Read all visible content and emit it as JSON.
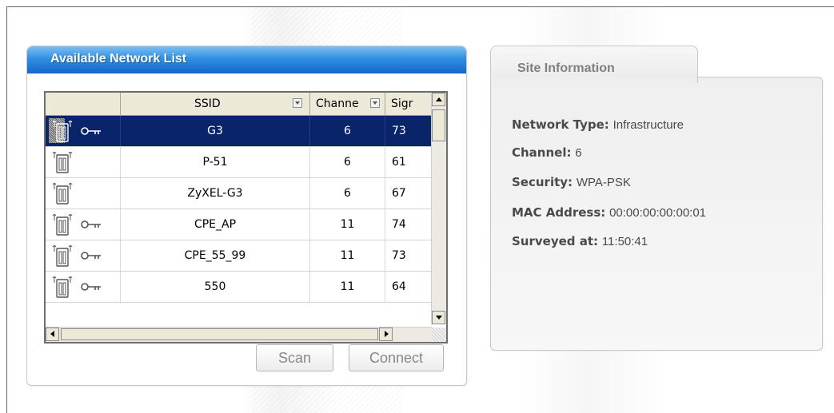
{
  "colors": {
    "header_blue": "#1f7ad8",
    "selected_row": "#0a246a",
    "panel_border": "#c8c8c8",
    "muted_text": "#888888"
  },
  "network_list": {
    "title": "Available Network List",
    "columns": [
      "",
      "SSID",
      "Channe",
      "Sigr"
    ],
    "rows": [
      {
        "ssid": "G3",
        "channel": "6",
        "signal": "73",
        "encrypted": true,
        "selected": true,
        "icon": "access-point-icon"
      },
      {
        "ssid": "P-51",
        "channel": "6",
        "signal": "61",
        "encrypted": false,
        "selected": false,
        "icon": "access-point-icon"
      },
      {
        "ssid": "ZyXEL-G3",
        "channel": "6",
        "signal": "67",
        "encrypted": false,
        "selected": false,
        "icon": "access-point-icon"
      },
      {
        "ssid": "CPE_AP",
        "channel": "11",
        "signal": "74",
        "encrypted": true,
        "selected": false,
        "icon": "access-point-icon"
      },
      {
        "ssid": "CPE_55_99",
        "channel": "11",
        "signal": "73",
        "encrypted": true,
        "selected": false,
        "icon": "access-point-icon"
      },
      {
        "ssid": "550",
        "channel": "11",
        "signal": "64",
        "encrypted": true,
        "selected": false,
        "icon": "access-point-icon"
      }
    ],
    "buttons": {
      "scan": "Scan",
      "connect": "Connect"
    }
  },
  "site_info": {
    "tab_title": "Site Information",
    "fields": [
      {
        "key": "Network Type:",
        "value": "Infrastructure"
      },
      {
        "key": "Channel:",
        "value": "6"
      },
      {
        "key": "Security:",
        "value": "WPA-PSK"
      },
      {
        "key": "MAC Address:",
        "value": "00:00:00:00:00:01"
      },
      {
        "key": "Surveyed at:",
        "value": "11:50:41"
      }
    ]
  }
}
